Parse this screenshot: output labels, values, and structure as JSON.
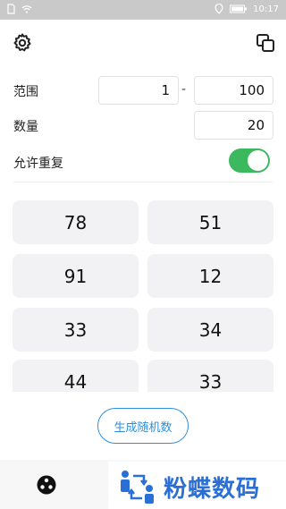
{
  "status_bar": {
    "time": "10:17"
  },
  "form": {
    "range_label": "范围",
    "range_min": "1",
    "range_sep": "-",
    "range_max": "100",
    "count_label": "数量",
    "count_value": "20",
    "repeat_label": "允许重复",
    "repeat_on": true
  },
  "results": [
    "78",
    "51",
    "91",
    "12",
    "33",
    "34",
    "44",
    "33"
  ],
  "generate_button": "生成随机数",
  "watermark": {
    "text": "粉蝶数码"
  },
  "colors": {
    "accent": "#2f8fd8",
    "toggle_on": "#3cb85f",
    "cell_bg": "#f2f2f4",
    "status_bar": "#c9c9c9"
  },
  "icons": {
    "settings": "gear-icon",
    "copy": "copy-icon",
    "dice": "dice-icon"
  }
}
